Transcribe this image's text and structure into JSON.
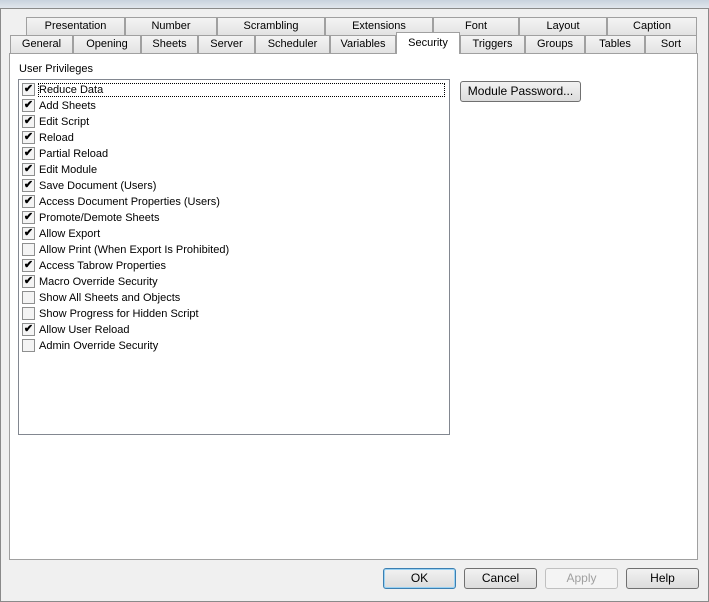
{
  "tabs_row1": [
    "Presentation",
    "Number",
    "Scrambling",
    "Extensions",
    "Font",
    "Layout",
    "Caption"
  ],
  "tabs_row2": [
    "General",
    "Opening",
    "Sheets",
    "Server",
    "Scheduler",
    "Variables",
    "Security",
    "Triggers",
    "Groups",
    "Tables",
    "Sort"
  ],
  "selected_tab": "Security",
  "group_label": "User Privileges",
  "privileges": [
    {
      "label": "Reduce Data",
      "checked": true
    },
    {
      "label": "Add Sheets",
      "checked": true
    },
    {
      "label": "Edit Script",
      "checked": true
    },
    {
      "label": "Reload",
      "checked": true
    },
    {
      "label": "Partial Reload",
      "checked": true
    },
    {
      "label": "Edit Module",
      "checked": true
    },
    {
      "label": "Save Document (Users)",
      "checked": true
    },
    {
      "label": "Access Document Properties (Users)",
      "checked": true
    },
    {
      "label": "Promote/Demote Sheets",
      "checked": true
    },
    {
      "label": "Allow Export",
      "checked": true
    },
    {
      "label": "Allow Print (When Export Is Prohibited)",
      "checked": false
    },
    {
      "label": "Access Tabrow Properties",
      "checked": true
    },
    {
      "label": "Macro Override Security",
      "checked": true
    },
    {
      "label": "Show All Sheets and Objects",
      "checked": false
    },
    {
      "label": "Show Progress for Hidden Script",
      "checked": false
    },
    {
      "label": "Allow User Reload",
      "checked": true
    },
    {
      "label": "Admin Override Security",
      "checked": false
    }
  ],
  "module_password_button": "Module Password...",
  "buttons": {
    "ok": "OK",
    "cancel": "Cancel",
    "apply": "Apply",
    "help": "Help"
  }
}
